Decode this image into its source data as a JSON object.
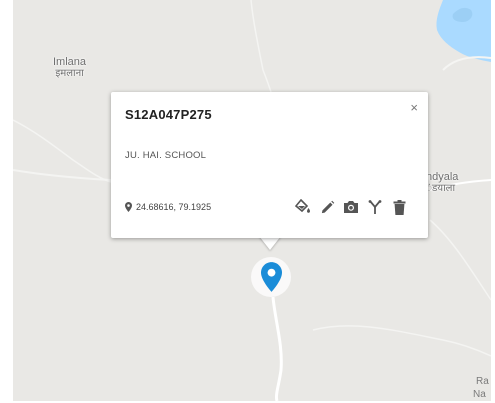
{
  "map": {
    "places": [
      {
        "name": "Imlana",
        "local": "इमलाना"
      },
      {
        "name": "ndyala",
        "local": "ंडयाला"
      }
    ],
    "edge_labels": [
      "Ra",
      "Na"
    ],
    "colors": {
      "land": "#e9e8e5",
      "water": "#aadaff",
      "road": "#ffffff",
      "marker": "#1a8cd8"
    }
  },
  "popup": {
    "title": "S12A047P275",
    "close_label": "×",
    "description": "JU. HAI. SCHOOL",
    "coordinates": "24.68616, 79.1925",
    "actions": [
      {
        "icon": "paint-bucket-icon",
        "label": "Style"
      },
      {
        "icon": "pencil-icon",
        "label": "Edit"
      },
      {
        "icon": "camera-icon",
        "label": "Photo"
      },
      {
        "icon": "fork-icon",
        "label": "Connect"
      },
      {
        "icon": "trash-icon",
        "label": "Delete"
      }
    ]
  }
}
